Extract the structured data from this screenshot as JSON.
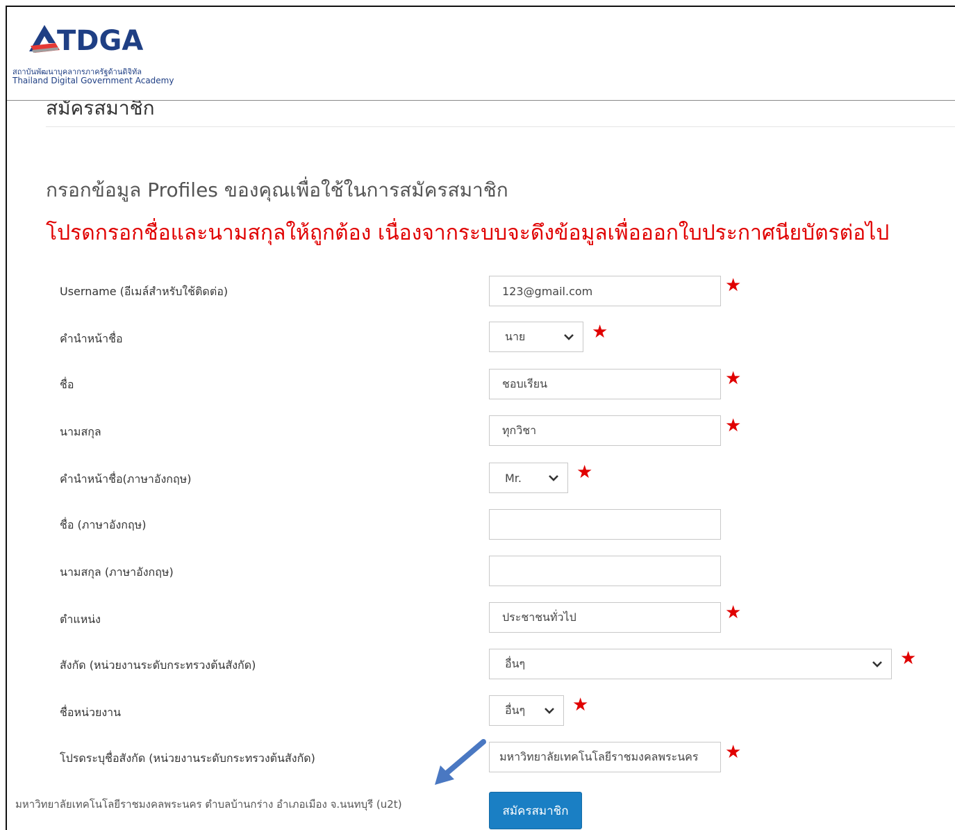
{
  "header": {
    "logo_text": "TDGA",
    "logo_thai": "สถาบันพัฒนาบุคลากรภาครัฐด้านดิจิทัล",
    "logo_english": "Thailand Digital Government Academy"
  },
  "page": {
    "cut_title": "สมัครสมาชิก",
    "subtitle": "กรอกข้อมูล Profiles ของคุณเพื่อใช้ในการสมัครสมาชิก",
    "warning": "โปรดกรอกชื่อและนามสกุลให้ถูกต้อง เนื่องจากระบบจะดึงข้อมูลเพื่อออกใบประกาศนียบัตรต่อไป"
  },
  "form": {
    "username": {
      "label": "Username (อีเมล์สำหรับใช้ติดต่อ)",
      "value": "123@gmail.com",
      "required": "★"
    },
    "title_th": {
      "label": "คำนำหน้าชื่อ",
      "value": "นาย",
      "required": "★"
    },
    "first_name": {
      "label": "ชื่อ",
      "value": "ชอบเรียน",
      "required": "★"
    },
    "last_name": {
      "label": "นามสกุล",
      "value": "ทุกวิชา",
      "required": "★"
    },
    "title_en": {
      "label": "คำนำหน้าชื่อ(ภาษาอังกฤษ)",
      "value": "Mr.",
      "required": "★"
    },
    "first_name_en": {
      "label": "ชื่อ (ภาษาอังกฤษ)",
      "value": ""
    },
    "last_name_en": {
      "label": "นามสกุล (ภาษาอังกฤษ)",
      "value": ""
    },
    "position": {
      "label": "ตำแหน่ง",
      "value": "ประชาชนทั่วไป",
      "required": "★"
    },
    "affiliation": {
      "label": "สังกัด (หน่วยงานระดับกระทรวงต้นสังกัด)",
      "value": "อื่นๆ",
      "required": "★"
    },
    "agency": {
      "label": "ชื่อหน่วยงาน",
      "value": "อื่นๆ",
      "required": "★"
    },
    "affiliation_specify": {
      "label": "โปรดระบุชื่อสังกัด (หน่วยงานระดับกระทรวงต้นสังกัด)",
      "value": "มหาวิทยาลัยเทคโนโลยีราชมงคลพระนคร",
      "required": "★"
    }
  },
  "annotation": {
    "note": "มหาวิทยาลัยเทคโนโลยีราชมงคลพระนคร ตำบลบ้านกร่าง อำเภอเมือง จ.นนทบุรี (u2t)"
  },
  "actions": {
    "submit_label": "สมัครสมาชิก"
  },
  "colors": {
    "accent": "#1a7fc4",
    "required": "#e00000",
    "logo": "#1f3f84"
  }
}
